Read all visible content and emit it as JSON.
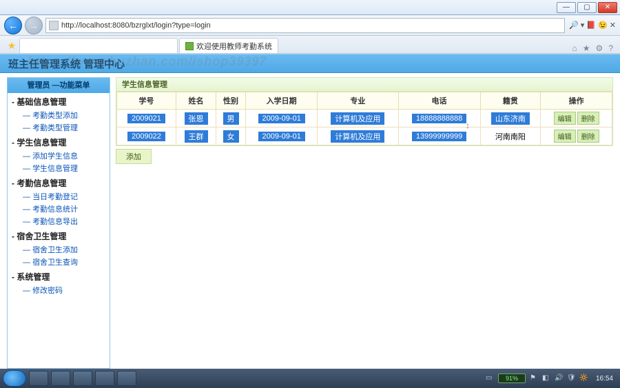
{
  "window": {
    "min": "—",
    "max": "▢",
    "close": "✕"
  },
  "ie": {
    "back": "←",
    "fwd": "→",
    "url": "http://localhost:8080/bzrglxt/login?type=login",
    "search_label": "🔎 ▾ 📕 😉 ✕",
    "tab_title": "欢迎使用教师考勤系统",
    "home": "⌂",
    "star": "★",
    "gear": "⚙",
    "help": "?"
  },
  "banner": {
    "title": "班主任管理系统  管理中心",
    "wm": "https://www.huzhan.com/ishop39397"
  },
  "sidebar": {
    "header": "管理员  —功能菜单",
    "cats": [
      {
        "name": "基础信息管理",
        "links": [
          "考勤类型添加",
          "考勤类型管理"
        ]
      },
      {
        "name": "学生信息管理",
        "links": [
          "添加学生信息",
          "学生信息管理"
        ]
      },
      {
        "name": "考勤信息管理",
        "links": [
          "当日考勤登记",
          "考勤信息统计",
          "考勤信息导出"
        ]
      },
      {
        "name": "宿舍卫生管理",
        "links": [
          "宿舍卫生添加",
          "宿舍卫生查询"
        ]
      },
      {
        "name": "系统管理",
        "links": [
          "修改密码"
        ]
      }
    ]
  },
  "panel": {
    "title": "学生信息管理",
    "cols": [
      "学号",
      "姓名",
      "性别",
      "入学日期",
      "专业",
      "电话",
      "籍贯",
      "操作"
    ],
    "edit": "编辑",
    "del": "删除",
    "add": "添加",
    "rows": [
      {
        "id": "2009021",
        "name": "张恩",
        "sex": "男",
        "date": "2009-09-01",
        "major": "计算机及应用",
        "phone": "18888888888",
        "home": "山东济南",
        "hl": true
      },
      {
        "id": "2009022",
        "name": "王群",
        "sex": "女",
        "date": "2009-09-01",
        "major": "计算机及应用",
        "phone": "13999999999",
        "home": "河南南阳",
        "hl": false
      }
    ]
  },
  "taskbar": {
    "battery": "91%",
    "time": "16:54"
  }
}
